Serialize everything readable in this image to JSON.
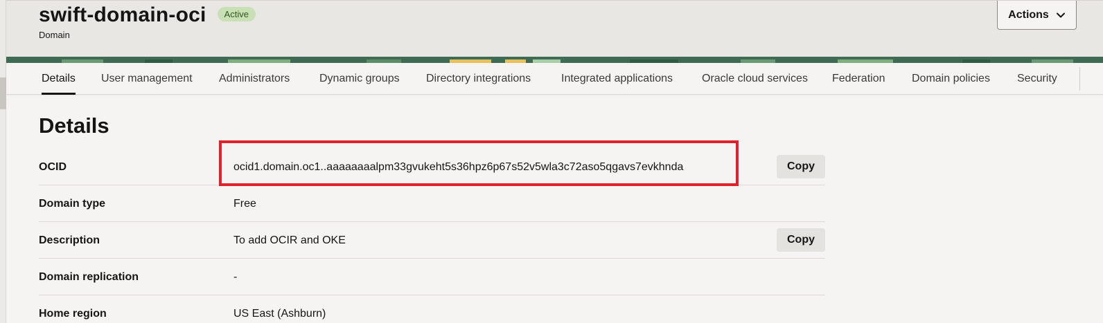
{
  "header": {
    "title": "swift-domain-oci",
    "status_badge": "Active",
    "subtitle": "Domain",
    "actions_label": "Actions"
  },
  "tabs": [
    {
      "label": "Details",
      "active": true
    },
    {
      "label": "User management"
    },
    {
      "label": "Administrators"
    },
    {
      "label": "Dynamic groups"
    },
    {
      "label": "Directory integrations"
    },
    {
      "label": "Integrated applications"
    },
    {
      "label": "Oracle cloud services"
    },
    {
      "label": "Federation"
    },
    {
      "label": "Domain policies"
    },
    {
      "label": "Security"
    }
  ],
  "details": {
    "title": "Details",
    "copy_label": "Copy",
    "rows": [
      {
        "label": "OCID",
        "value": "ocid1.domain.oc1..aaaaaaaalpm33gvukeht5s36hpz6p67s52v5wla3c72aso5qgavs7evkhnda"
      },
      {
        "label": "Domain type",
        "value": "Free"
      },
      {
        "label": "Description",
        "value": "To add OCIR and OKE"
      },
      {
        "label": "Domain replication",
        "value": "-"
      },
      {
        "label": "Home region",
        "value": "US East (Ashburn)"
      }
    ]
  },
  "colors": {
    "highlight": "#e0212b",
    "badge_bg": "#c9e0b6",
    "banner": "#3f6b54"
  },
  "icons": {
    "actions": "chevron-down-icon"
  }
}
